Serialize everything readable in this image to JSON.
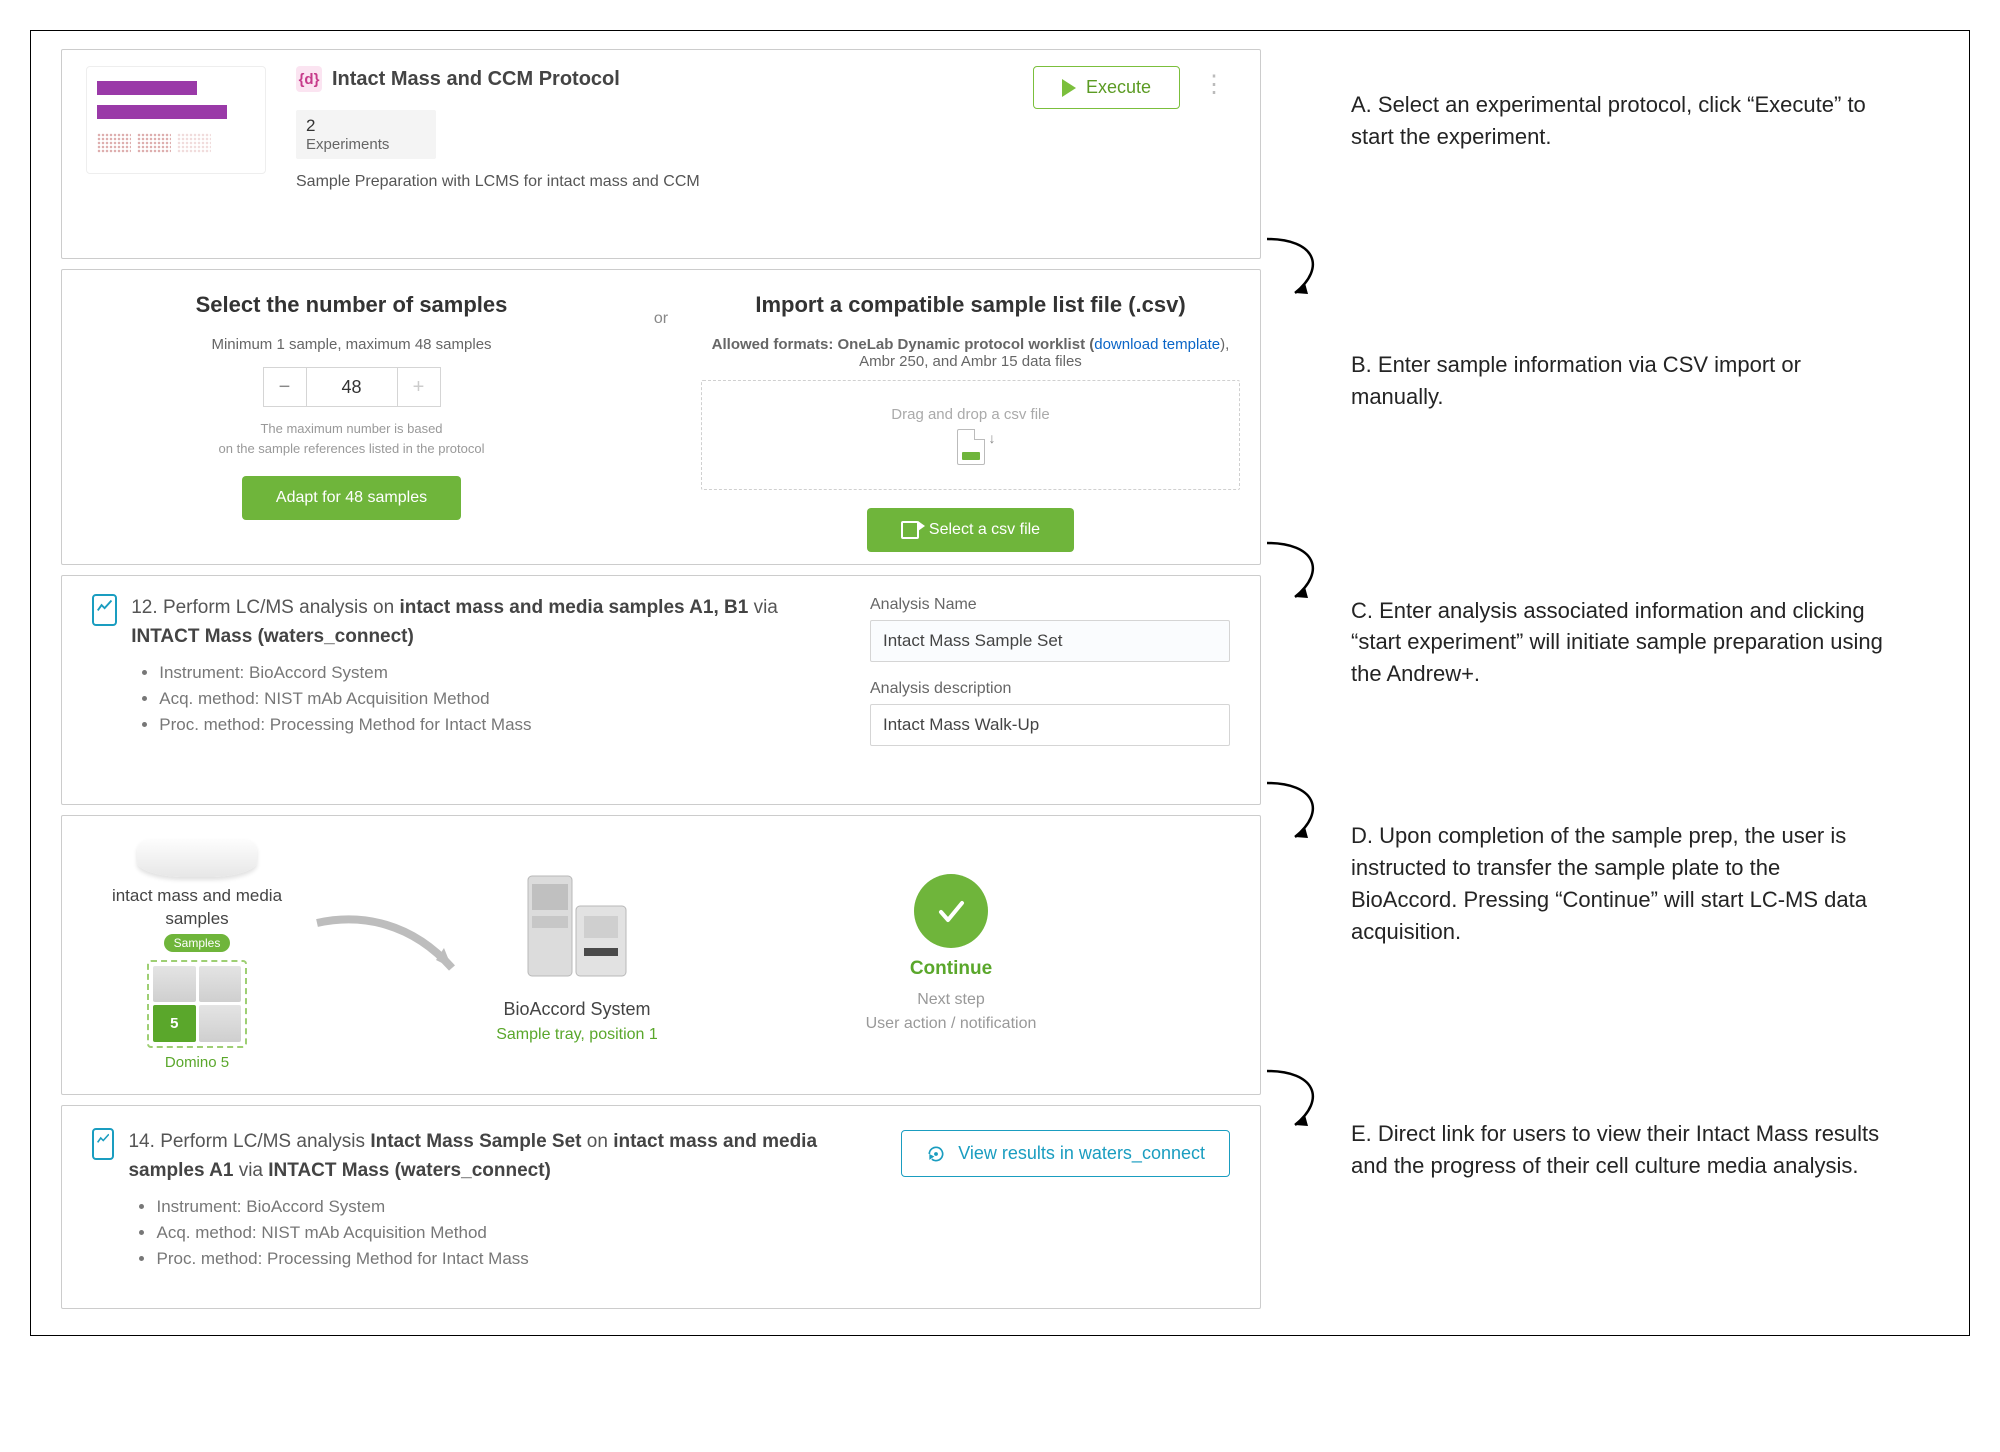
{
  "stepA": {
    "icon_letter": "{d}",
    "title": "Intact Mass and CCM Protocol",
    "exp_count": "2",
    "exp_label": "Experiments",
    "description": "Sample Preparation with LCMS for intact mass and CCM",
    "execute_label": "Execute"
  },
  "stepB": {
    "left_heading": "Select the number of samples",
    "left_sub": "Minimum 1 sample, maximum 48 samples",
    "sample_value": "48",
    "left_note1": "The maximum number is based",
    "left_note2": "on the sample references listed in the protocol",
    "adapt_label": "Adapt for 48 samples",
    "or": "or",
    "right_heading": "Import a compatible sample list file (.csv)",
    "right_sub_pre": "Allowed formats: OneLab Dynamic protocol worklist (",
    "right_sub_link": "download template",
    "right_sub_post": "),",
    "right_sub2": "Ambr 250, and Ambr 15 data files",
    "drop_text": "Drag and drop a csv file",
    "select_label": "Select a csv file"
  },
  "stepC": {
    "num": "12.",
    "title_p1": "Perform LC/MS analysis on ",
    "title_b1": "intact mass and media samples A1, B1",
    "title_p2": " via ",
    "title_b2": "INTACT Mass (waters_connect)",
    "b_instr_l": "Instrument: ",
    "b_instr_v": "BioAccord System",
    "b_acq_l": "Acq. method: ",
    "b_acq_v": "NIST mAb Acquisition Method",
    "b_proc_l": "Proc. method: ",
    "b_proc_v": "Processing Method for Intact Mass",
    "analysis_name_label": "Analysis Name",
    "analysis_name_value": "Intact Mass Sample Set",
    "analysis_desc_label": "Analysis description",
    "analysis_desc_value": "Intact Mass Walk-Up"
  },
  "stepD": {
    "plate_label": "intact mass and media samples",
    "samples_tag": "Samples",
    "domino": "Domino 5",
    "system": "BioAccord System",
    "position": "Sample tray, position 1",
    "continue": "Continue",
    "next_step": "Next step",
    "user_action": "User action / notification"
  },
  "stepE": {
    "num": "14.",
    "title_p1": "Perform LC/MS analysis ",
    "title_b1": "Intact Mass Sample Set",
    "title_p2": " on ",
    "title_b2": "intact mass and media samples A1",
    "title_p3": " via ",
    "title_b3": "INTACT Mass (waters_connect)",
    "b_instr_l": "Instrument: ",
    "b_instr_v": "BioAccord System",
    "b_acq_l": "Acq. method: ",
    "b_acq_v": "NIST mAb Acquisition Method",
    "b_proc_l": "Proc. method: ",
    "b_proc_v": "Processing Method for Intact Mass",
    "view_label": "View results in waters_connect"
  },
  "annotations": {
    "A": "A. Select an experimental protocol, click “Execute” to start the experiment.",
    "B": "B. Enter sample information via CSV import or manually.",
    "C": "C. Enter analysis associated information and clicking “start experiment” will initiate sample preparation using the Andrew+.",
    "D": "D. Upon completion of the sample prep, the user is instructed to transfer the sample plate to the BioAccord. Pressing “Continue” will start LC-MS data acquisition.",
    "E": "E. Direct link for users to view their Intact Mass results and the progress of their cell culture media analysis."
  }
}
